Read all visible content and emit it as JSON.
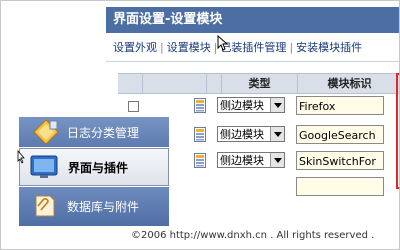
{
  "panel": {
    "title": "界面设置-设置模块",
    "tabs": [
      "设置外观",
      "设置模块",
      "已装插件管理",
      "安装模块插件"
    ],
    "columns": {
      "type": "类型",
      "module_id": "模块标识"
    },
    "rows": [
      {
        "type": "侧边模块",
        "module_id": "Firefox"
      },
      {
        "type": "侧边模块",
        "module_id": "GoogleSearch"
      },
      {
        "type": "侧边模块",
        "module_id": "SkinSwitchFor"
      },
      {
        "type": "",
        "module_id": ""
      }
    ]
  },
  "nav": {
    "items": [
      {
        "label": "日志分类管理",
        "icon": "diamond-icon"
      },
      {
        "label": "界面与插件",
        "icon": "monitor-icon",
        "active": true
      },
      {
        "label": "数据库与附件",
        "icon": "paperclip-icon"
      }
    ]
  },
  "footer": {
    "copyright": "©2006 http://www.dnxh.cn . All rights reserved ."
  },
  "colors": {
    "header_bg": "#4d6ea3",
    "highlight_border": "#e0252b",
    "nav_bg": "#5d7bb0"
  }
}
